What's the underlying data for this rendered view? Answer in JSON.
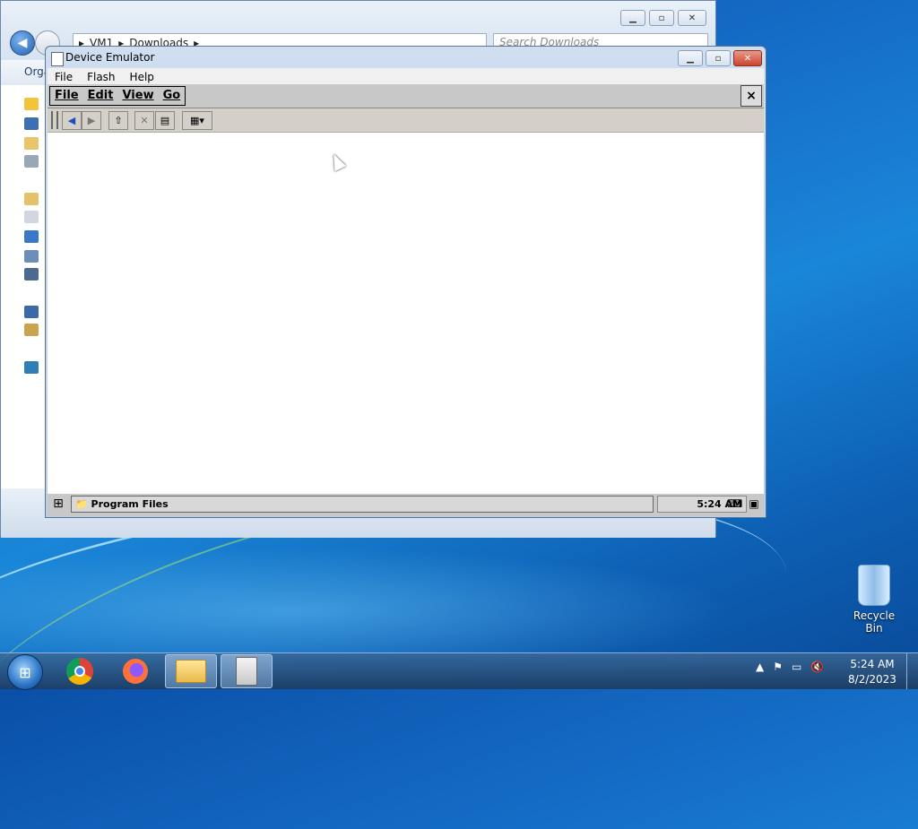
{
  "explorer": {
    "path": [
      "VM1",
      "Downloads"
    ],
    "search_placeholder": "Search Downloads",
    "organize_label": "Orga"
  },
  "emulator": {
    "title": "Device Emulator",
    "menu": [
      "File",
      "Flash",
      "Help"
    ]
  },
  "ce": {
    "menu": [
      "File",
      "Edit",
      "View",
      "Go"
    ],
    "close_label": "×",
    "taskbar_button": "Program Files",
    "tray_time": "5:24 AM"
  },
  "desktop": {
    "recycle_bin_label": "Recycle Bin"
  },
  "taskbar": {
    "time": "5:24 AM",
    "date": "8/2/2023"
  },
  "icons": [
    "back-icon",
    "forward-icon",
    "up-folder-icon",
    "delete-icon",
    "properties-icon",
    "views-icon",
    "chrome-icon",
    "firefox-icon",
    "folder-icon",
    "device-icon",
    "recycle-bin-icon"
  ]
}
